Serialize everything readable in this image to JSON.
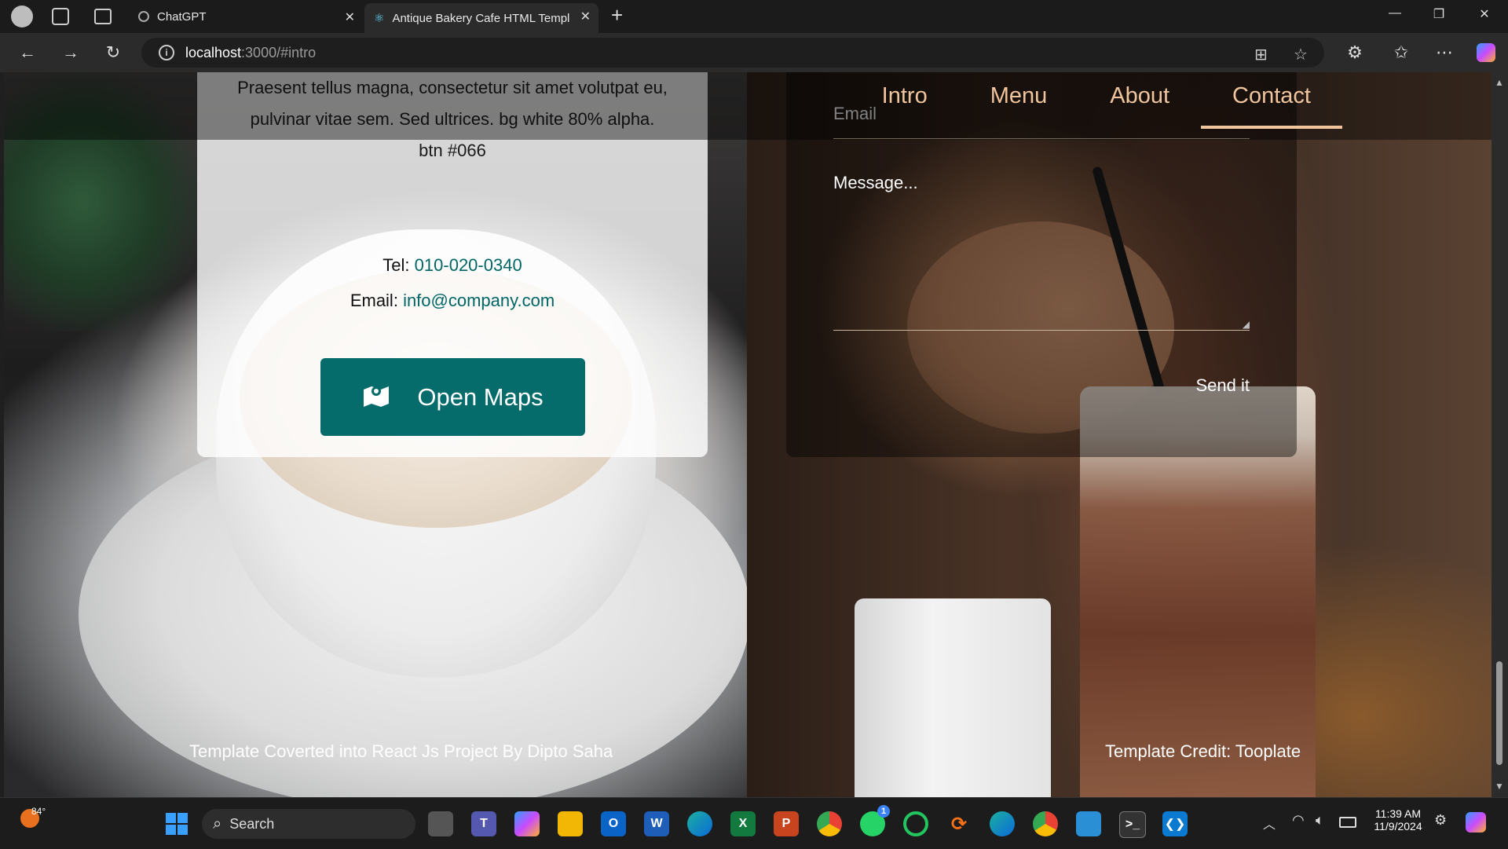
{
  "browser": {
    "tabs": [
      {
        "title": "ChatGPT",
        "active": false,
        "icon": "chatgpt-icon"
      },
      {
        "title": "Antique Bakery Cafe HTML Templ",
        "active": true,
        "icon": "react-icon"
      }
    ],
    "new_tab": "+",
    "address": {
      "host": "localhost",
      "path": ":3000/#intro"
    }
  },
  "site": {
    "nav": [
      {
        "label": "Intro"
      },
      {
        "label": "Menu"
      },
      {
        "label": "About"
      },
      {
        "label": "Contact",
        "active": true
      }
    ],
    "about_text": "Praesent tellus magna, consectetur sit amet volutpat eu, pulvinar vitae sem. Sed ultrices. bg white 80% alpha. btn #066",
    "tel_label": "Tel:",
    "tel_value": "010-020-0340",
    "email_label": "Email:",
    "email_value": "info@company.com",
    "maps_button": "Open Maps",
    "form": {
      "email_placeholder": "Email",
      "message_placeholder": "Message...",
      "send_label": "Send it"
    },
    "footer_left": "Template Coverted into React Js Project By Dipto Saha",
    "footer_right": "Template Credit: Tooplate"
  },
  "taskbar": {
    "weather": "84°",
    "search": "Search",
    "time": "11:39 AM",
    "date": "11/9/2024",
    "whatsapp_badge": "1"
  },
  "colors": {
    "accent_nav": "#f0c59e",
    "button_teal": "#066b6b",
    "link_teal": "#006666"
  }
}
